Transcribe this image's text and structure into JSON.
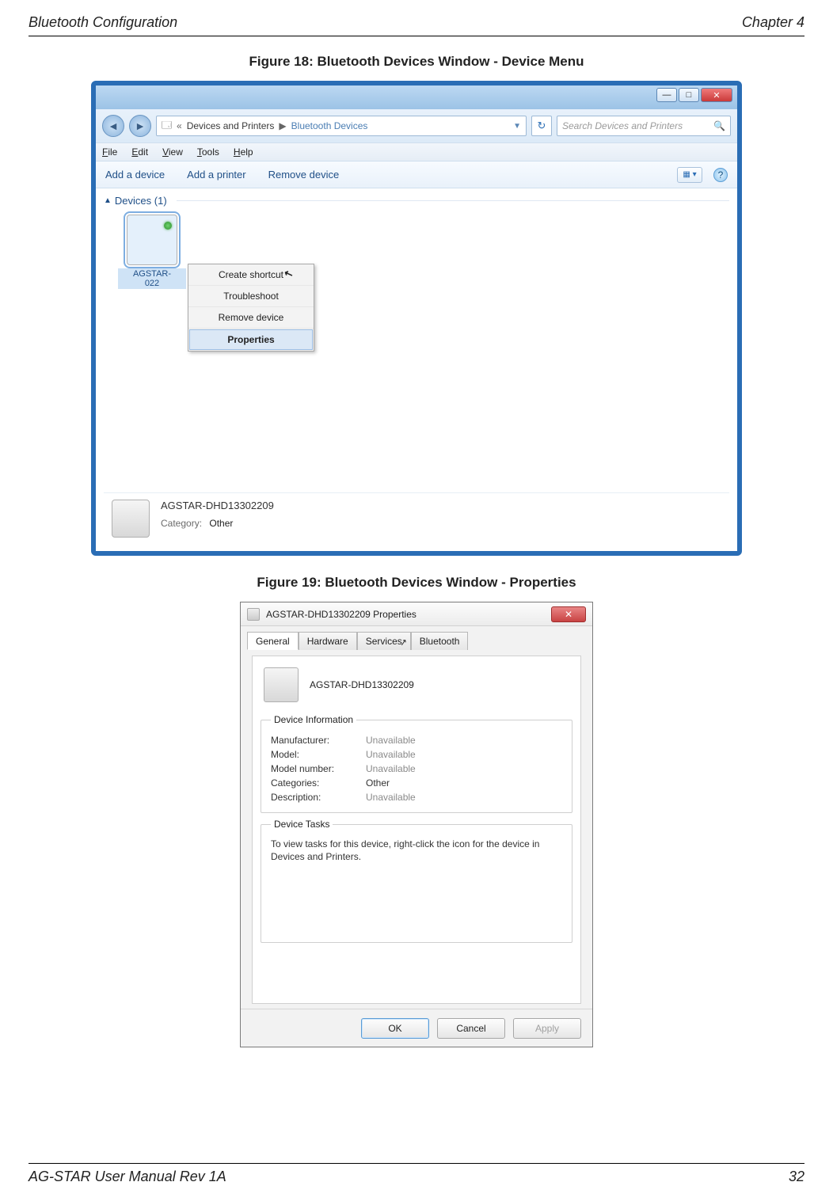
{
  "page": {
    "header_left": "Bluetooth Configuration",
    "header_right": "Chapter 4",
    "footer_left": "AG-STAR User Manual Rev 1A",
    "footer_right": "32"
  },
  "figure18": {
    "caption": "Figure 18: Bluetooth Devices Window - Device Menu",
    "window_controls": {
      "min": "—",
      "max": "□",
      "close": "✕"
    },
    "breadcrumb": {
      "chev": "«",
      "items": [
        "Devices and Printers",
        "Bluetooth Devices"
      ]
    },
    "search_placeholder": "Search Devices and Printers",
    "menu": [
      "File",
      "Edit",
      "View",
      "Tools",
      "Help"
    ],
    "toolbar": [
      "Add a device",
      "Add a printer",
      "Remove device"
    ],
    "group_title": "Devices (1)",
    "device_label_line1": "AGSTAR-",
    "device_label_line2": "022",
    "context_menu": [
      "Create shortcut",
      "Troubleshoot",
      "Remove device",
      "Properties"
    ],
    "details": {
      "name": "AGSTAR-DHD13302209",
      "category_label": "Category:",
      "category_value": "Other"
    }
  },
  "figure19": {
    "caption": "Figure 19: Bluetooth Devices Window - Properties",
    "title": "AGSTAR-DHD13302209 Properties",
    "tabs": [
      "General",
      "Hardware",
      "Services",
      "Bluetooth"
    ],
    "device_name": "AGSTAR-DHD13302209",
    "info_legend": "Device Information",
    "info": [
      {
        "k": "Manufacturer:",
        "v": "Unavailable",
        "dark": false
      },
      {
        "k": "Model:",
        "v": "Unavailable",
        "dark": false
      },
      {
        "k": "Model number:",
        "v": "Unavailable",
        "dark": false
      },
      {
        "k": "Categories:",
        "v": "Other",
        "dark": true
      },
      {
        "k": "Description:",
        "v": "Unavailable",
        "dark": false
      }
    ],
    "tasks_legend": "Device Tasks",
    "tasks_text": "To view tasks for this device, right-click the icon for the device in Devices and Printers.",
    "buttons": {
      "ok": "OK",
      "cancel": "Cancel",
      "apply": "Apply"
    }
  }
}
